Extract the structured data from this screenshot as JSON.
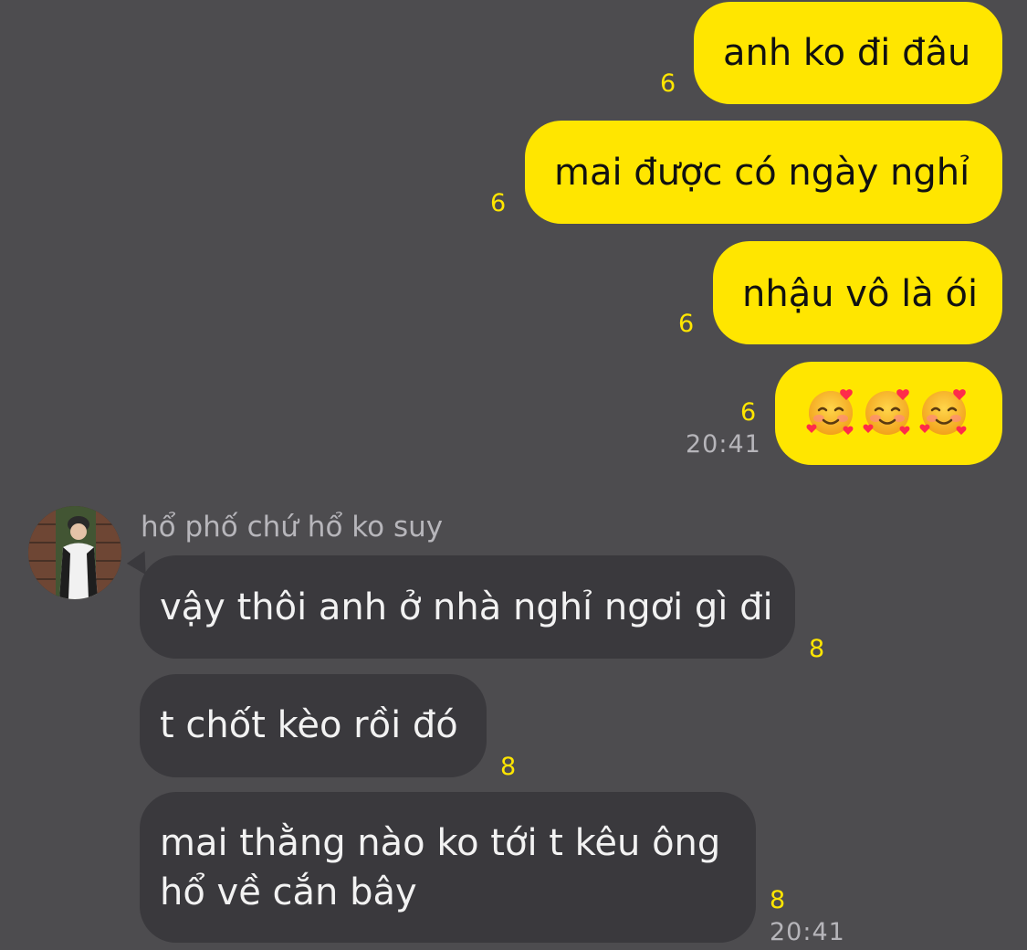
{
  "outgoing": [
    {
      "text": "anh ko đi đâu",
      "count": "6"
    },
    {
      "text": "mai được có ngày nghỉ",
      "count": "6"
    },
    {
      "text": "nhậu vô là ói",
      "count": "6"
    },
    {
      "text": "🥰🥰🥰",
      "emoji_icons": [
        "smiling-face-with-hearts-icon",
        "smiling-face-with-hearts-icon",
        "smiling-face-with-hearts-icon"
      ],
      "count": "6",
      "time": "20:41"
    }
  ],
  "incoming_sender": {
    "name": "hổ phố chứ hổ ko suy",
    "avatar_icon": "avatar"
  },
  "incoming": [
    {
      "text": "vậy thôi anh ở nhà nghỉ ngơi gì đi",
      "count": "8"
    },
    {
      "text": "t chốt kèo rồi đó",
      "count": "8"
    },
    {
      "line1": "mai thằng nào ko tới t kêu ông",
      "line2": "hổ về cắn bây",
      "count": "8",
      "time": "20:41"
    }
  ],
  "colors": {
    "background": "#4d4c4f",
    "sent_bubble": "#ffe600",
    "received_bubble": "#3a393d",
    "unread_count": "#ffe600"
  }
}
